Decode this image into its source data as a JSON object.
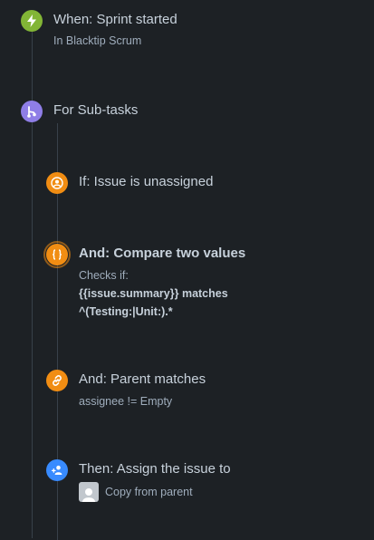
{
  "trigger": {
    "title": "When: Sprint started",
    "subtitle": "In Blacktip Scrum",
    "icon": "lightning-icon",
    "color": "#82b536"
  },
  "branch": {
    "title": "For Sub-tasks",
    "icon": "branch-icon",
    "color": "#8f7ee7"
  },
  "condition_unassigned": {
    "title": "If: Issue is unassigned",
    "icon": "user-circle-icon",
    "color": "#f18d13"
  },
  "condition_compare": {
    "title": "And: Compare two values",
    "line1": "Checks if:",
    "line2": "{{issue.summary}} matches",
    "line3": "^(Testing:|Unit:).*",
    "icon": "braces-icon",
    "color": "#f18d13"
  },
  "condition_parent": {
    "title": "And: Parent matches",
    "subtitle": "assignee != Empty",
    "icon": "link-icon",
    "color": "#f18d13"
  },
  "action_assign": {
    "title": "Then: Assign the issue to",
    "assignee_label": "Copy from parent",
    "icon": "assign-user-icon",
    "color": "#388bff"
  }
}
